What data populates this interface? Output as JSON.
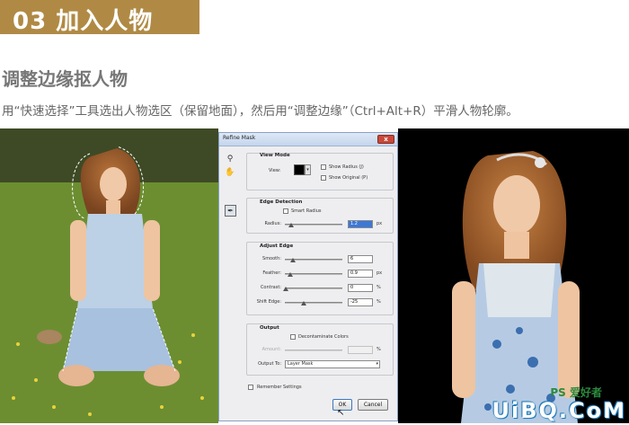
{
  "header": {
    "step_title": "03 加入人物",
    "subtitle": "调整边缘抠人物",
    "description": "用“快速选择”工具选出人物选区（保留地面），然后用“调整边缘”（Ctrl+Alt+R）平滑人物轮廓。"
  },
  "dialog": {
    "title": "Refine Mask",
    "close_label": "x",
    "view_mode": {
      "label": "View Mode",
      "view_label": "View:",
      "show_radius": "Show Radius (J)",
      "show_original": "Show Original (P)"
    },
    "edge_detection": {
      "label": "Edge Detection",
      "smart_radius": "Smart Radius",
      "radius_label": "Radius:",
      "radius_value": "1.2",
      "radius_unit": "px"
    },
    "adjust_edge": {
      "label": "Adjust Edge",
      "smooth_label": "Smooth:",
      "smooth_value": "6",
      "feather_label": "Feather:",
      "feather_value": "0.9",
      "feather_unit": "px",
      "contrast_label": "Contrast:",
      "contrast_value": "0",
      "contrast_unit": "%",
      "shift_label": "Shift Edge:",
      "shift_value": "-25",
      "shift_unit": "%"
    },
    "output": {
      "label": "Output",
      "decontaminate": "Decontaminate Colors",
      "amount_label": "Amount:",
      "amount_unit": "%",
      "output_to_label": "Output To:",
      "output_to_value": "Layer Mask"
    },
    "remember": "Remember Settings",
    "ok_label": "OK",
    "cancel_label": "Cancel"
  },
  "watermark": {
    "text": "UiBQ.CoM",
    "ps_text": "PS 爱好者"
  },
  "icons": {
    "zoom": "magnifier-icon",
    "hand": "hand-icon",
    "brush": "refine-brush-icon",
    "cursor": "mouse-pointer-icon"
  },
  "colors": {
    "banner": "#b08a45",
    "dialog_bg": "#eeeef0",
    "highlight": "#3d78d6"
  }
}
